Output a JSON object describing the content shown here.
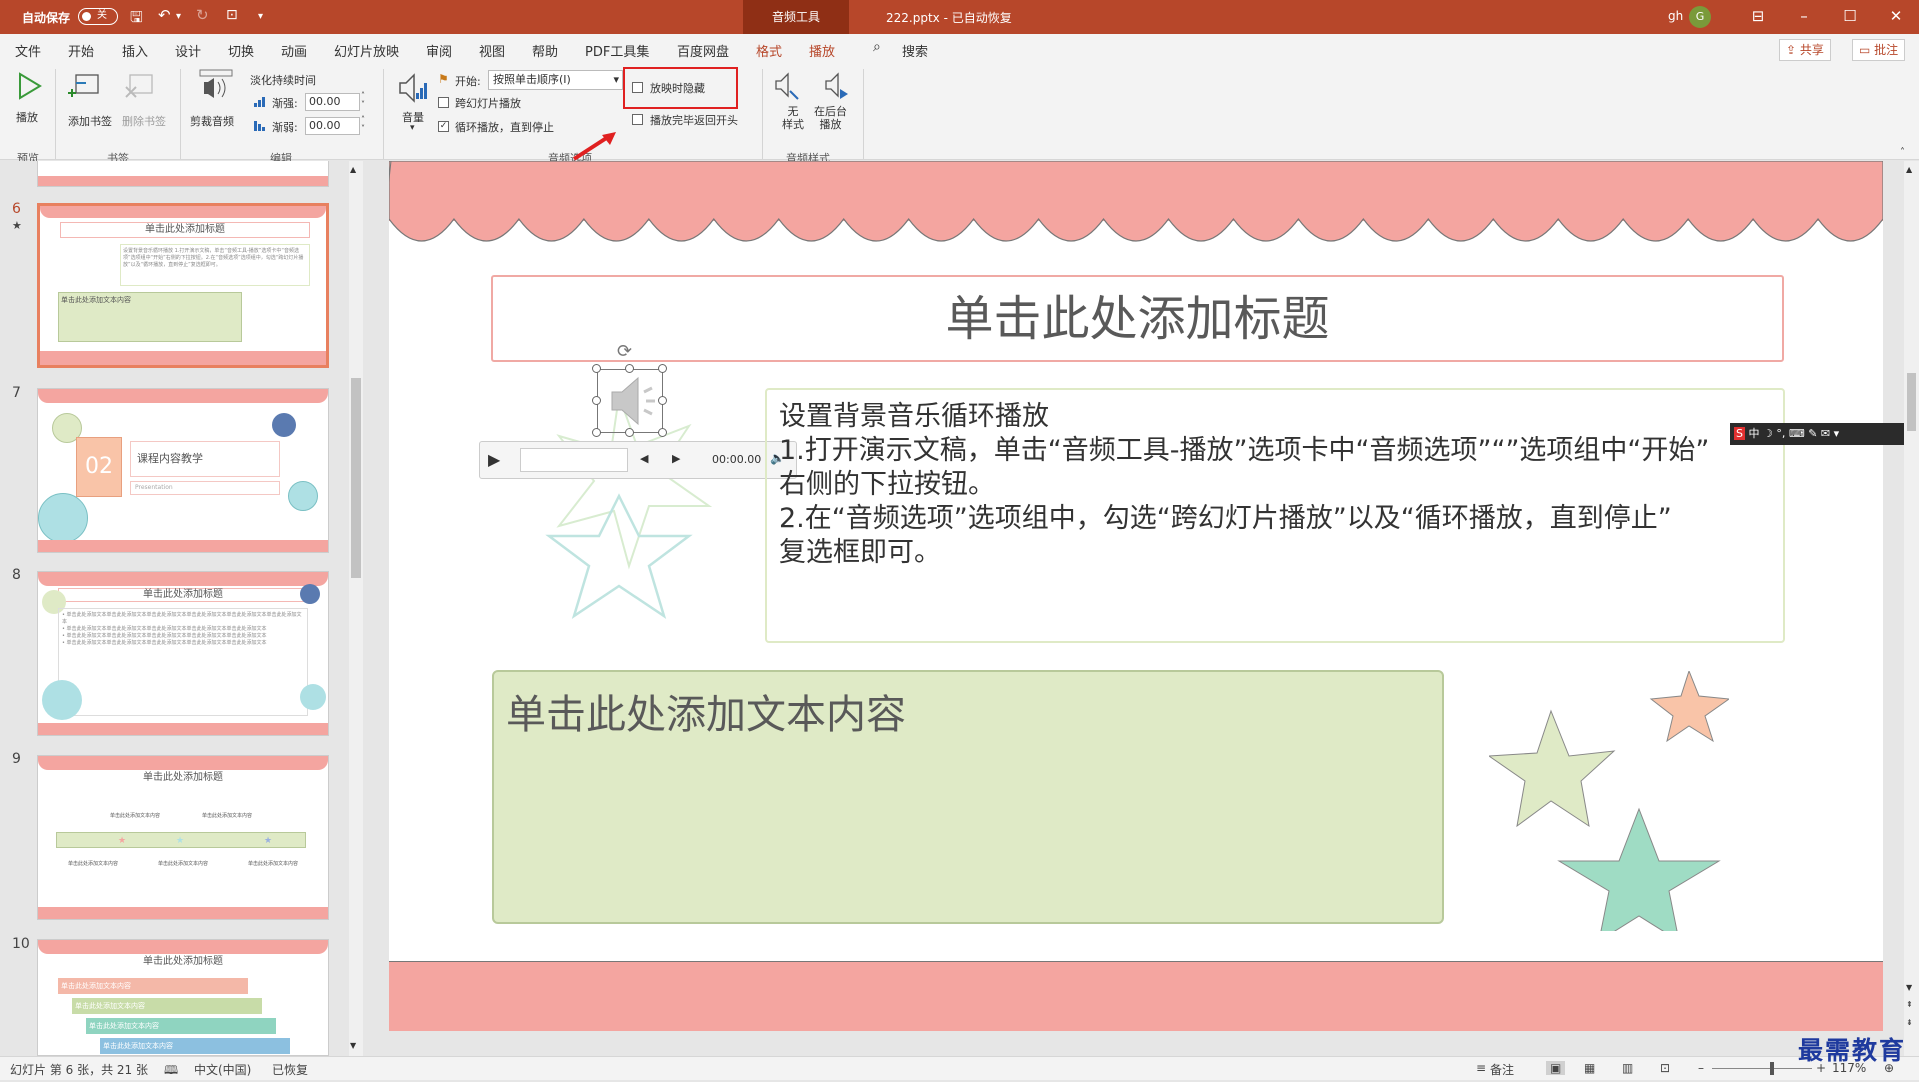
{
  "titlebar": {
    "autosave_label": "自动保存",
    "autosave_state": "关",
    "context_tab": "音频工具",
    "doc_title": "222.pptx  -  已自动恢复",
    "user": "gh",
    "avatar_letter": "G"
  },
  "menu": {
    "items": [
      "文件",
      "开始",
      "插入",
      "设计",
      "切换",
      "动画",
      "幻灯片放映",
      "审阅",
      "视图",
      "帮助",
      "PDF工具集",
      "百度网盘",
      "格式",
      "播放"
    ],
    "search": "搜索",
    "share": "共享",
    "comment": "批注"
  },
  "ribbon": {
    "play": "播放",
    "add_bookmark": "添加书签",
    "remove_bookmark": "删除书签",
    "trim_audio": "剪裁音频",
    "fade_duration": "淡化持续时间",
    "fade_in_label": "渐强:",
    "fade_in_value": "00.00",
    "fade_out_label": "渐弱:",
    "fade_out_value": "00.00",
    "volume": "音量",
    "start_label": "开始:",
    "start_value": "按照单击顺序(I)",
    "cross_slides": "跨幻灯片播放",
    "loop_until_stop": "循环播放，直到停止",
    "hide_during_show": "放映时隐藏",
    "rewind_after_play": "播放完毕返回开头",
    "no_style": "无\n样式",
    "play_in_background": "在后台\n播放",
    "groups": {
      "preview": "预览",
      "bookmarks": "书签",
      "editing": "编辑",
      "audio_options": "音频选项",
      "audio_styles": "音频样式"
    }
  },
  "thumbnails": [
    {
      "num": "6",
      "title": "单击此处添加标题",
      "body": "单击此处添加文本内容"
    },
    {
      "num": "7",
      "badge": "02",
      "title": "课程内容教学",
      "sub": "Presentation"
    },
    {
      "num": "8",
      "title": "单击此处添加标题"
    },
    {
      "num": "9",
      "title": "单击此处添加标题",
      "labels": [
        "单击此处添加文本内容",
        "单击此处添加文本内容",
        "单击此处添加文本内容",
        "单击此处添加文本内容",
        "单击此处添加文本内容"
      ]
    },
    {
      "num": "10",
      "title": "单击此处添加标题",
      "rows": [
        "单击此处添加文本内容",
        "单击此处添加文本内容",
        "单击此处添加文本内容",
        "单击此处添加文本内容"
      ]
    }
  ],
  "slide": {
    "title": "单击此处添加标题",
    "body_lines": [
      "设置背景音乐循环播放",
      "1.打开演示文稿，单击“音频工具-播放”选项卡中“音频选项”“”选项组中“开始”",
      "右侧的下拉按钮。",
      "2.在“音频选项”选项组中，勾选“跨幻灯片播放”以及“循环播放，直到停止”",
      "复选框即可。"
    ],
    "content_placeholder": "单击此处添加文本内容",
    "player_time": "00:00.00"
  },
  "ime": {
    "label": "中"
  },
  "status": {
    "slide_info": "幻灯片 第 6 张，共 21 张",
    "language": "中文(中国)",
    "recovered": "已恢复",
    "notes": "备注",
    "zoom": "117%"
  },
  "watermark": "最需教育",
  "colors": {
    "accent": "#b7472a",
    "highlight_box": "#e02020",
    "slide_pink": "#f4a5a0",
    "slide_green": "#dfeac6"
  }
}
